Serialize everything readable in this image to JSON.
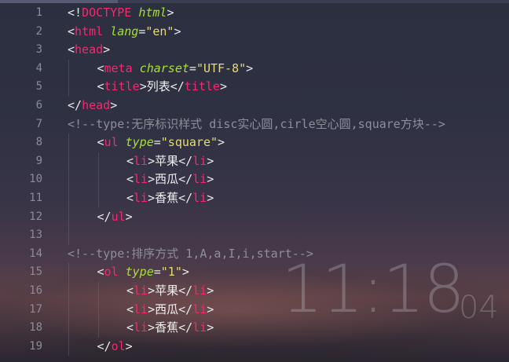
{
  "editor": {
    "line_numbers": [
      "1",
      "2",
      "3",
      "4",
      "5",
      "6",
      "7",
      "8",
      "9",
      "10",
      "11",
      "12",
      "13",
      "14",
      "15",
      "16",
      "17",
      "18",
      "19"
    ],
    "lines": [
      {
        "indent": 0,
        "tokens": [
          [
            "p",
            "<!"
          ],
          [
            "kw",
            "DOCTYPE"
          ],
          [
            "p",
            " "
          ],
          [
            "attr",
            "html"
          ],
          [
            "p",
            ">"
          ]
        ]
      },
      {
        "indent": 0,
        "tokens": [
          [
            "p",
            "<"
          ],
          [
            "kw",
            "html"
          ],
          [
            "p",
            " "
          ],
          [
            "attr",
            "lang"
          ],
          [
            "p",
            "="
          ],
          [
            "str",
            "\"en\""
          ],
          [
            "p",
            ">"
          ]
        ]
      },
      {
        "indent": 0,
        "tokens": [
          [
            "p",
            "<"
          ],
          [
            "kw",
            "head"
          ],
          [
            "p",
            ">"
          ]
        ]
      },
      {
        "indent": 1,
        "tokens": [
          [
            "p",
            "<"
          ],
          [
            "kw",
            "meta"
          ],
          [
            "p",
            " "
          ],
          [
            "attr",
            "charset"
          ],
          [
            "p",
            "="
          ],
          [
            "str",
            "\"UTF-8\""
          ],
          [
            "p",
            ">"
          ]
        ]
      },
      {
        "indent": 1,
        "tokens": [
          [
            "p",
            "<"
          ],
          [
            "kw",
            "title"
          ],
          [
            "p",
            ">"
          ],
          [
            "txt",
            "列表"
          ],
          [
            "p",
            "</"
          ],
          [
            "kw",
            "title"
          ],
          [
            "p",
            ">"
          ]
        ]
      },
      {
        "indent": 0,
        "tokens": [
          [
            "p",
            "</"
          ],
          [
            "kw",
            "head"
          ],
          [
            "p",
            ">"
          ]
        ]
      },
      {
        "indent": 0,
        "tokens": [
          [
            "cm",
            "<!--type:无序标识样式 disc实心圆,cirle空心圆,square方块-->"
          ]
        ]
      },
      {
        "indent": 1,
        "tokens": [
          [
            "p",
            "<"
          ],
          [
            "kw",
            "ul"
          ],
          [
            "p",
            " "
          ],
          [
            "attr",
            "type"
          ],
          [
            "p",
            "="
          ],
          [
            "str",
            "\"square\""
          ],
          [
            "p",
            ">"
          ]
        ]
      },
      {
        "indent": 2,
        "tokens": [
          [
            "p",
            "<"
          ],
          [
            "kw",
            "li"
          ],
          [
            "p",
            ">"
          ],
          [
            "txt",
            "苹果"
          ],
          [
            "p",
            "</"
          ],
          [
            "kw",
            "li"
          ],
          [
            "p",
            ">"
          ]
        ]
      },
      {
        "indent": 2,
        "tokens": [
          [
            "p",
            "<"
          ],
          [
            "kw",
            "li"
          ],
          [
            "p",
            ">"
          ],
          [
            "txt",
            "西瓜"
          ],
          [
            "p",
            "</"
          ],
          [
            "kw",
            "li"
          ],
          [
            "p",
            ">"
          ]
        ]
      },
      {
        "indent": 2,
        "tokens": [
          [
            "p",
            "<"
          ],
          [
            "kw",
            "li"
          ],
          [
            "p",
            ">"
          ],
          [
            "txt",
            "香蕉"
          ],
          [
            "p",
            "</"
          ],
          [
            "kw",
            "li"
          ],
          [
            "p",
            ">"
          ]
        ]
      },
      {
        "indent": 1,
        "tokens": [
          [
            "p",
            "</"
          ],
          [
            "kw",
            "ul"
          ],
          [
            "p",
            ">"
          ]
        ]
      },
      {
        "indent": 0,
        "tokens": []
      },
      {
        "indent": 0,
        "tokens": [
          [
            "cm",
            "<!--type:排序方式 1,A,a,I,i,start-->"
          ]
        ]
      },
      {
        "indent": 1,
        "tokens": [
          [
            "p",
            "<"
          ],
          [
            "kw",
            "ol"
          ],
          [
            "p",
            " "
          ],
          [
            "attr",
            "type"
          ],
          [
            "p",
            "="
          ],
          [
            "str",
            "\"1\""
          ],
          [
            "p",
            ">"
          ]
        ]
      },
      {
        "indent": 2,
        "tokens": [
          [
            "p",
            "<"
          ],
          [
            "kw",
            "li"
          ],
          [
            "p",
            ">"
          ],
          [
            "txt",
            "苹果"
          ],
          [
            "p",
            "</"
          ],
          [
            "kw",
            "li"
          ],
          [
            "p",
            ">"
          ]
        ]
      },
      {
        "indent": 2,
        "tokens": [
          [
            "p",
            "<"
          ],
          [
            "kw",
            "li"
          ],
          [
            "p",
            ">"
          ],
          [
            "txt",
            "西瓜"
          ],
          [
            "p",
            "</"
          ],
          [
            "kw",
            "li"
          ],
          [
            "p",
            ">"
          ]
        ]
      },
      {
        "indent": 2,
        "tokens": [
          [
            "p",
            "<"
          ],
          [
            "kw",
            "li"
          ],
          [
            "p",
            ">"
          ],
          [
            "txt",
            "香蕉"
          ],
          [
            "p",
            "</"
          ],
          [
            "kw",
            "li"
          ],
          [
            "p",
            ">"
          ]
        ]
      },
      {
        "indent": 1,
        "tokens": [
          [
            "p",
            "</"
          ],
          [
            "kw",
            "ol"
          ],
          [
            "p",
            ">"
          ]
        ]
      }
    ]
  },
  "wallpaper": {
    "clock_time": "11:18",
    "clock_seconds": "04"
  },
  "colors": {
    "tag": "#f92672",
    "attribute": "#a6e22e",
    "string": "#e6db74",
    "comment": "#8e8e9a",
    "line_number": "#8a8c9a"
  }
}
